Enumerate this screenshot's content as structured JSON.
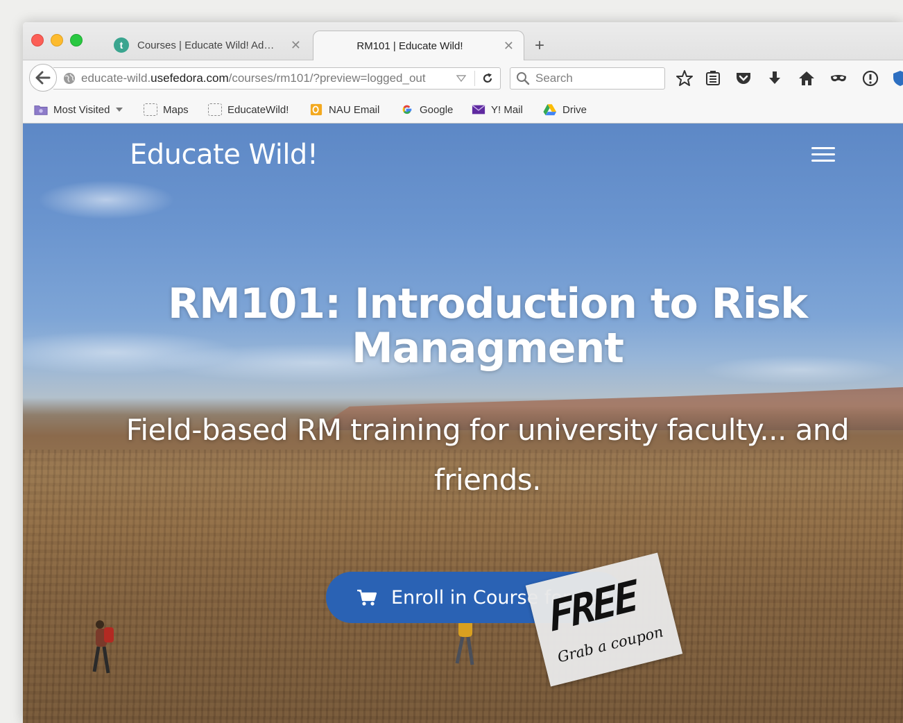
{
  "browser": {
    "tabs": [
      {
        "title": "Courses | Educate Wild! Ad…",
        "favicon_letter": "t",
        "active": false
      },
      {
        "title": "RM101 | Educate Wild!",
        "active": true
      }
    ],
    "new_tab_label": "+",
    "url": {
      "prefix": "educate-wild.",
      "domain": "usefedora.com",
      "path": "/courses/rm101/?preview=logged_out"
    },
    "search_placeholder": "Search",
    "bookmarks": [
      {
        "label": "Most Visited",
        "icon": "folder-icon"
      },
      {
        "label": "Maps",
        "icon": "dotted-page-icon"
      },
      {
        "label": "EducateWild!",
        "icon": "dotted-page-icon"
      },
      {
        "label": "NAU Email",
        "icon": "outlook-icon"
      },
      {
        "label": "Google",
        "icon": "google-icon"
      },
      {
        "label": "Y! Mail",
        "icon": "mail-icon"
      },
      {
        "label": "Drive",
        "icon": "drive-icon"
      }
    ],
    "toolbar_icons": [
      "star-icon",
      "reading-list-icon",
      "pocket-icon",
      "download-icon",
      "home-icon",
      "private-mask-icon",
      "info-icon",
      "shield-icon"
    ]
  },
  "page": {
    "brand": "Educate Wild!",
    "hero_title": "RM101: Introduction to Risk Managment",
    "hero_subtitle": "Field-based RM training for university faculty... and friends.",
    "enroll_button": "Enroll in Course for $95",
    "coupon": {
      "headline": "FREE",
      "subtext": "Grab a coupon"
    }
  },
  "colors": {
    "button_blue": "#2a62b4",
    "sky": "#5d88c6",
    "tab_favicon": "#3aa58f"
  }
}
